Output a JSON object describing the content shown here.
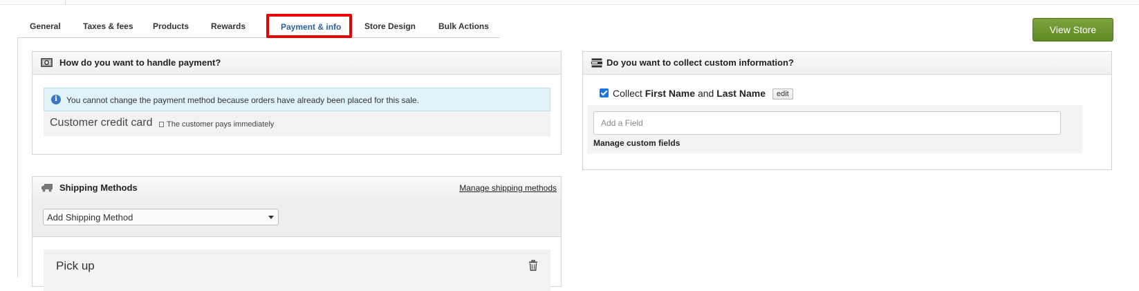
{
  "tabs": [
    {
      "label": "General"
    },
    {
      "label": "Taxes & fees"
    },
    {
      "label": "Products"
    },
    {
      "label": "Rewards"
    },
    {
      "label": "Payment & info",
      "active": true
    },
    {
      "label": "Store Design"
    },
    {
      "label": "Bulk Actions"
    }
  ],
  "header": {
    "view_store_label": "View Store"
  },
  "payment": {
    "title": "How do you want to handle payment?",
    "icon": "cash-icon",
    "alert_text": "You cannot change the payment method because orders have already been placed for this sale.",
    "method": "Customer credit card",
    "method_note": "The customer pays immediately"
  },
  "shipping": {
    "title": "Shipping Methods",
    "icon": "truck-icon",
    "manage_link": "Manage shipping methods",
    "select_value": "Add Shipping Method",
    "methods": [
      {
        "label": "Pick up"
      }
    ]
  },
  "custom_info": {
    "title": "Do you want to collect custom information?",
    "icon": "form-list-icon",
    "collect_prefix": "Collect",
    "first_name": "First Name",
    "and_text": "and",
    "last_name": "Last Name",
    "collect_checked": true,
    "edit_label": "edit",
    "add_field_placeholder": "Add a Field",
    "manage_fields_label": "Manage custom fields"
  },
  "colors": {
    "active_tab": "#2a5f9e",
    "highlight_border": "#ee0000",
    "view_store_button": "#6a9530",
    "alert_background": "#dff3f9",
    "checkbox": "#1a73e8"
  }
}
